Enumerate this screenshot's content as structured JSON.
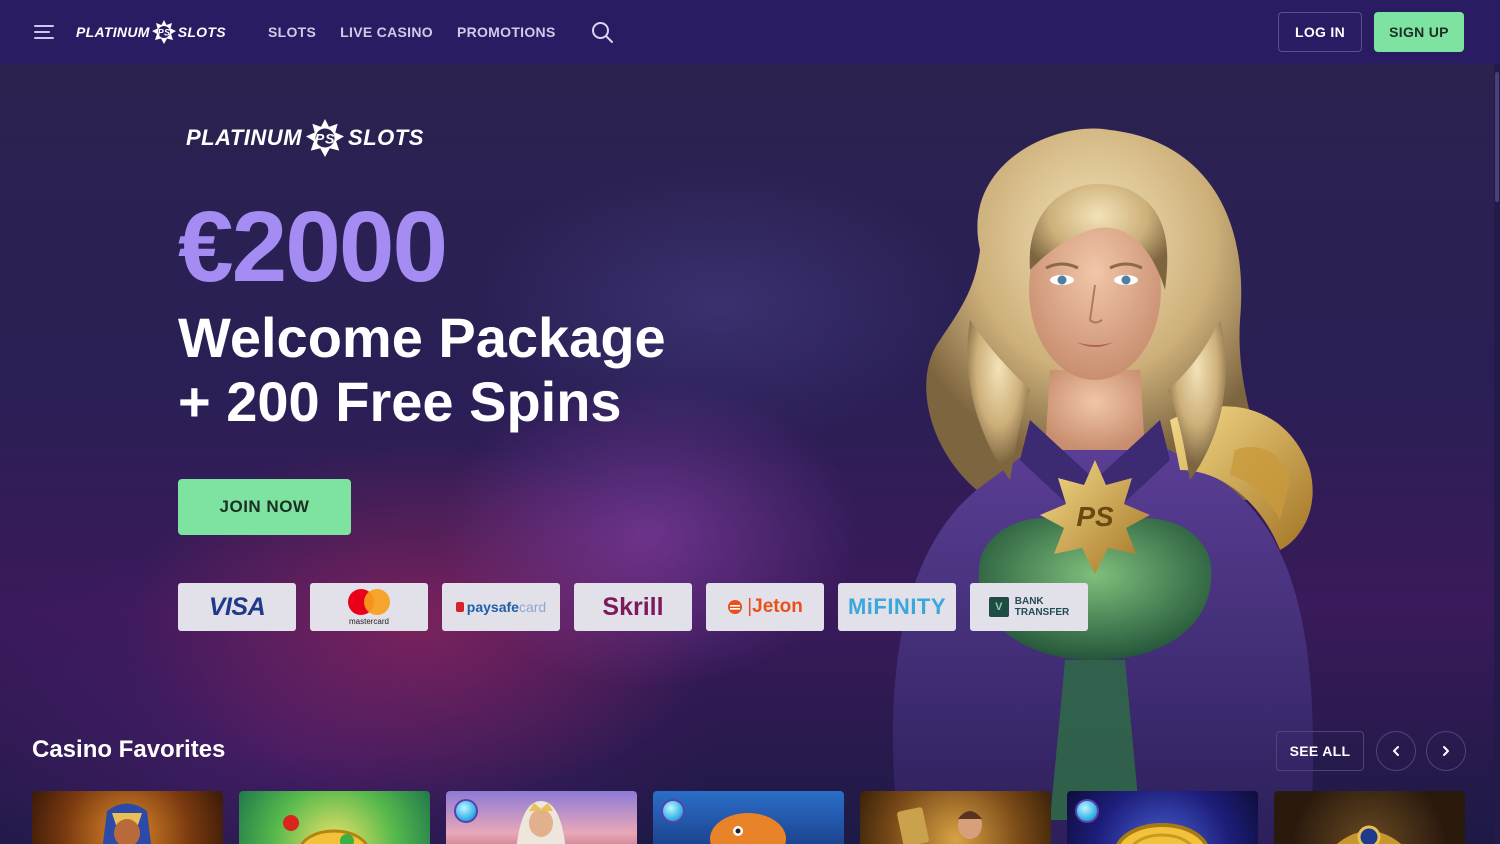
{
  "navbar": {
    "logo_left": "PLATINUM",
    "logo_right": "SLOTS",
    "links": [
      "SLOTS",
      "LIVE CASINO",
      "PROMOTIONS"
    ],
    "login_label": "LOG IN",
    "signup_label": "SIGN UP"
  },
  "hero": {
    "logo_left": "PLATINUM",
    "logo_right": "SLOTS",
    "amount": "€2000",
    "headline_line1": "Welcome Package",
    "headline_line2": "+ 200 Free Spins",
    "cta_label": "JOIN NOW",
    "payments": {
      "visa": "VISA",
      "mastercard": "mastercard",
      "paysafecard_a": "paysafe",
      "paysafecard_b": "card",
      "skrill": "Skrill",
      "jeton": "Jeton",
      "mifinity": "MiFINITY",
      "bank_line1": "BANK",
      "bank_line2": "TRANSFER"
    }
  },
  "favorites": {
    "title": "Casino Favorites",
    "see_all_label": "SEE ALL"
  },
  "colors": {
    "accent_green": "#7ee2a0",
    "amount_purple": "#a58cf2",
    "nav_bg": "#2a1c63"
  },
  "icons": [
    "menu-icon",
    "search-icon",
    "chevron-left-icon",
    "chevron-right-icon",
    "ps-badge-icon"
  ]
}
